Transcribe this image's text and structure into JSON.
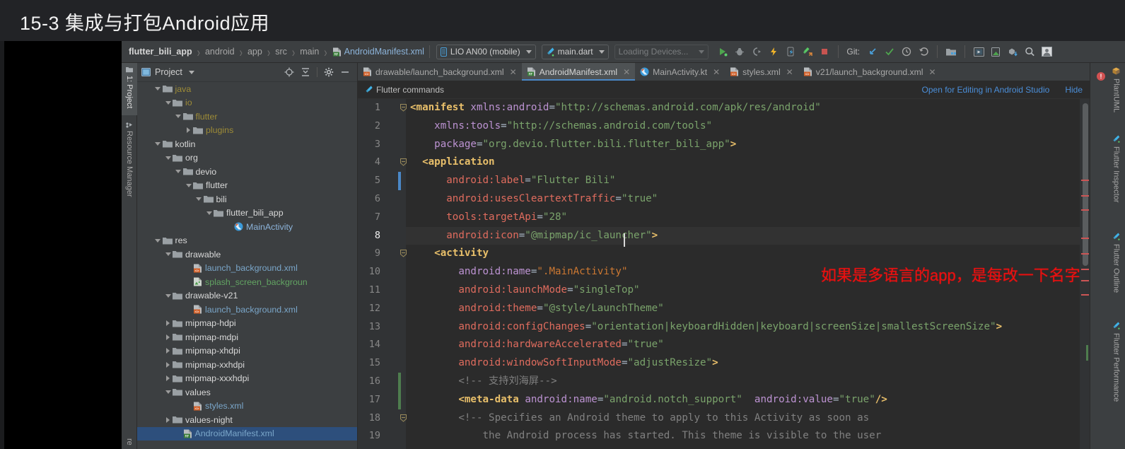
{
  "slide": {
    "title": "15-3 集成与打包Android应用"
  },
  "breadcrumb": {
    "items": [
      {
        "label": "flutter_bili_app",
        "style": "bold"
      },
      {
        "label": "android",
        "style": "normal"
      },
      {
        "label": "app",
        "style": "normal"
      },
      {
        "label": "src",
        "style": "normal"
      },
      {
        "label": "main",
        "style": "normal"
      },
      {
        "label": "AndroidManifest.xml",
        "style": "file",
        "icon": "xml-manifest-icon"
      }
    ],
    "separator": "›"
  },
  "toolbar": {
    "device_selector": "LIO AN00 (mobile)",
    "device_icon": "phone-icon",
    "run_config": "main.dart",
    "run_config_icon": "flutter-icon",
    "loading_devices": "Loading Devices...",
    "git_label": "Git:",
    "buttons": [
      {
        "name": "run-button",
        "icon": "play-icon"
      },
      {
        "name": "debug-button",
        "icon": "bug-icon"
      },
      {
        "name": "run-coverage-button",
        "icon": "coverage-icon"
      },
      {
        "name": "hot-reload-button",
        "icon": "lightning-icon"
      },
      {
        "name": "hot-restart-button",
        "icon": "restart-icon"
      },
      {
        "name": "open-devtools-button",
        "icon": "devtools-icon"
      },
      {
        "name": "stop-button",
        "icon": "stop-icon"
      },
      {
        "name": "git-update-button",
        "icon": "arrow-down-left-icon"
      },
      {
        "name": "git-commit-button",
        "icon": "check-icon"
      },
      {
        "name": "git-history-button",
        "icon": "clock-icon"
      },
      {
        "name": "git-rollback-button",
        "icon": "undo-icon"
      },
      {
        "name": "project-structure-button",
        "icon": "project-structure-icon"
      },
      {
        "name": "avd-manager-button",
        "icon": "avd-icon"
      },
      {
        "name": "sdk-manager-button",
        "icon": "sdk-icon"
      },
      {
        "name": "gradle-sync-button",
        "icon": "sync-icon"
      },
      {
        "name": "search-everywhere-button",
        "icon": "search-icon"
      },
      {
        "name": "account-button",
        "icon": "user-icon"
      }
    ]
  },
  "left_strip": {
    "tabs": [
      {
        "label": "1: Project",
        "active": true,
        "icon": "project-icon"
      },
      {
        "label": "Resource Manager",
        "active": false,
        "icon": "resource-icon"
      },
      {
        "label": "re",
        "active": false,
        "icon": ""
      }
    ]
  },
  "project_panel": {
    "title": "Project",
    "tools": [
      {
        "name": "locate-icon"
      },
      {
        "name": "collapse-all-icon"
      },
      {
        "name": "gear-icon"
      },
      {
        "name": "minimize-icon"
      }
    ],
    "tree": [
      {
        "label": "java",
        "indent": 5,
        "twisty": "down",
        "icon": "folder",
        "color": "pkg"
      },
      {
        "label": "io",
        "indent": 6,
        "twisty": "down",
        "icon": "folder",
        "color": "pkg"
      },
      {
        "label": "flutter",
        "indent": 7,
        "twisty": "down",
        "icon": "folder",
        "color": "pkg"
      },
      {
        "label": "plugins",
        "indent": 8,
        "twisty": "right",
        "icon": "folder",
        "color": "pkg"
      },
      {
        "label": "kotlin",
        "indent": 5,
        "twisty": "down",
        "icon": "folder",
        "color": "white"
      },
      {
        "label": "org",
        "indent": 6,
        "twisty": "down",
        "icon": "folder",
        "color": "white"
      },
      {
        "label": "devio",
        "indent": 7,
        "twisty": "down",
        "icon": "folder",
        "color": "white"
      },
      {
        "label": "flutter",
        "indent": 8,
        "twisty": "down",
        "icon": "folder",
        "color": "white"
      },
      {
        "label": "bili",
        "indent": 9,
        "twisty": "down",
        "icon": "folder",
        "color": "white"
      },
      {
        "label": "flutter_bili_app",
        "indent": 10,
        "twisty": "down",
        "icon": "folder",
        "color": "white"
      },
      {
        "label": "MainActivity",
        "indent": 12,
        "twisty": "none",
        "icon": "kotlin",
        "color": "blue"
      },
      {
        "label": "res",
        "indent": 5,
        "twisty": "down",
        "icon": "folder",
        "color": "white"
      },
      {
        "label": "drawable",
        "indent": 6,
        "twisty": "down",
        "icon": "folder",
        "color": "white"
      },
      {
        "label": "launch_background.xml",
        "indent": 8,
        "twisty": "none",
        "icon": "xml",
        "color": "xml"
      },
      {
        "label": "splash_screen_backgroun",
        "indent": 8,
        "twisty": "none",
        "icon": "png",
        "color": "green"
      },
      {
        "label": "drawable-v21",
        "indent": 6,
        "twisty": "down",
        "icon": "folder",
        "color": "white"
      },
      {
        "label": "launch_background.xml",
        "indent": 8,
        "twisty": "none",
        "icon": "xml",
        "color": "xml"
      },
      {
        "label": "mipmap-hdpi",
        "indent": 6,
        "twisty": "right",
        "icon": "folder",
        "color": "white"
      },
      {
        "label": "mipmap-mdpi",
        "indent": 6,
        "twisty": "right",
        "icon": "folder",
        "color": "white"
      },
      {
        "label": "mipmap-xhdpi",
        "indent": 6,
        "twisty": "right",
        "icon": "folder",
        "color": "white"
      },
      {
        "label": "mipmap-xxhdpi",
        "indent": 6,
        "twisty": "right",
        "icon": "folder",
        "color": "white"
      },
      {
        "label": "mipmap-xxxhdpi",
        "indent": 6,
        "twisty": "right",
        "icon": "folder",
        "color": "white"
      },
      {
        "label": "values",
        "indent": 6,
        "twisty": "down",
        "icon": "folder",
        "color": "white"
      },
      {
        "label": "styles.xml",
        "indent": 8,
        "twisty": "none",
        "icon": "xml",
        "color": "xml"
      },
      {
        "label": "values-night",
        "indent": 6,
        "twisty": "right",
        "icon": "folder",
        "color": "white"
      },
      {
        "label": "AndroidManifest.xml",
        "indent": 7,
        "twisty": "none",
        "icon": "manifest",
        "color": "xml",
        "selected": true
      }
    ]
  },
  "editor": {
    "tabs": [
      {
        "label": "drawable/launch_background.xml",
        "icon": "xml-icon",
        "active": false
      },
      {
        "label": "AndroidManifest.xml",
        "icon": "manifest-icon",
        "active": true
      },
      {
        "label": "MainActivity.kt",
        "icon": "kotlin-icon",
        "active": false
      },
      {
        "label": "styles.xml",
        "icon": "xml-icon",
        "active": false
      },
      {
        "label": "v21/launch_background.xml",
        "icon": "xml-icon",
        "active": false
      }
    ],
    "close_glyph": "✕",
    "flutter_bar": {
      "label": "Flutter commands",
      "icon": "flutter-icon",
      "open_link": "Open for Editing in Android Studio",
      "hide_link": "Hide"
    },
    "annotation": "如果是多语言的app，是每改一下名字打一下包吗?",
    "annotation_color": "#e81010",
    "current_line": 8,
    "lines": [
      {
        "n": 1,
        "fold": "start",
        "tokens": [
          {
            "t": "<manifest ",
            "c": "tag"
          },
          {
            "t": "xmlns:android",
            "c": "attr"
          },
          {
            "t": "=",
            "c": "eq"
          },
          {
            "t": "\"http://schemas.android.com/apk/res/android\"",
            "c": "val"
          }
        ]
      },
      {
        "n": 2,
        "tokens": [
          {
            "t": "    ",
            "c": "plain"
          },
          {
            "t": "xmlns:tools",
            "c": "attr"
          },
          {
            "t": "=",
            "c": "eq"
          },
          {
            "t": "\"http://schemas.android.com/tools\"",
            "c": "val"
          }
        ]
      },
      {
        "n": 3,
        "tokens": [
          {
            "t": "    ",
            "c": "plain"
          },
          {
            "t": "package",
            "c": "attr"
          },
          {
            "t": "=",
            "c": "eq"
          },
          {
            "t": "\"org.devio.flutter.bili.flutter_bili_app\"",
            "c": "val"
          },
          {
            "t": ">",
            "c": "tag"
          }
        ]
      },
      {
        "n": 4,
        "fold": "start",
        "tokens": [
          {
            "t": "  <application",
            "c": "tag"
          }
        ]
      },
      {
        "n": 5,
        "mark": "blue",
        "tokens": [
          {
            "t": "      ",
            "c": "plain"
          },
          {
            "t": "android:label",
            "c": "attrR"
          },
          {
            "t": "=",
            "c": "eq"
          },
          {
            "t": "\"Flutter Bili\"",
            "c": "val"
          }
        ]
      },
      {
        "n": 6,
        "tokens": [
          {
            "t": "      ",
            "c": "plain"
          },
          {
            "t": "android:usesCleartextTraffic",
            "c": "attrR"
          },
          {
            "t": "=",
            "c": "eq"
          },
          {
            "t": "\"true\"",
            "c": "val"
          }
        ]
      },
      {
        "n": 7,
        "tokens": [
          {
            "t": "      ",
            "c": "plain"
          },
          {
            "t": "tools:targetApi",
            "c": "attrR"
          },
          {
            "t": "=",
            "c": "eq"
          },
          {
            "t": "\"28\"",
            "c": "val"
          }
        ]
      },
      {
        "n": 8,
        "current": true,
        "tokens": [
          {
            "t": "      ",
            "c": "plain"
          },
          {
            "t": "android:icon",
            "c": "attrR"
          },
          {
            "t": "=",
            "c": "eq"
          },
          {
            "t": "\"@mipmap/ic_launcher\"",
            "c": "val"
          },
          {
            "t": ">",
            "c": "tag"
          }
        ]
      },
      {
        "n": 9,
        "fold": "start",
        "tokens": [
          {
            "t": "    <activity",
            "c": "tag"
          }
        ]
      },
      {
        "n": 10,
        "tokens": [
          {
            "t": "        ",
            "c": "plain"
          },
          {
            "t": "android:name",
            "c": "attr"
          },
          {
            "t": "=",
            "c": "eq"
          },
          {
            "t": "\".MainActivity\"",
            "c": "valR"
          }
        ]
      },
      {
        "n": 11,
        "tokens": [
          {
            "t": "        ",
            "c": "plain"
          },
          {
            "t": "android:launchMode",
            "c": "attrR"
          },
          {
            "t": "=",
            "c": "eq"
          },
          {
            "t": "\"singleTop\"",
            "c": "val"
          }
        ]
      },
      {
        "n": 12,
        "tokens": [
          {
            "t": "        ",
            "c": "plain"
          },
          {
            "t": "android:theme",
            "c": "attrR"
          },
          {
            "t": "=",
            "c": "eq"
          },
          {
            "t": "\"@style/LaunchTheme\"",
            "c": "val"
          }
        ]
      },
      {
        "n": 13,
        "tokens": [
          {
            "t": "        ",
            "c": "plain"
          },
          {
            "t": "android:configChanges",
            "c": "attrR"
          },
          {
            "t": "=",
            "c": "eq"
          },
          {
            "t": "\"orientation|keyboardHidden|keyboard|screenSize|smallestScreenSize\"",
            "c": "val"
          },
          {
            "t": ">",
            "c": "tag"
          }
        ]
      },
      {
        "n": 14,
        "tokens": [
          {
            "t": "        ",
            "c": "plain"
          },
          {
            "t": "android:hardwareAccelerated",
            "c": "attrR"
          },
          {
            "t": "=",
            "c": "eq"
          },
          {
            "t": "\"true\"",
            "c": "val"
          }
        ]
      },
      {
        "n": 15,
        "tokens": [
          {
            "t": "        ",
            "c": "plain"
          },
          {
            "t": "android:windowSoftInputMode",
            "c": "attrR"
          },
          {
            "t": "=",
            "c": "eq"
          },
          {
            "t": "\"adjustResize\"",
            "c": "val"
          },
          {
            "t": ">",
            "c": "tag"
          }
        ]
      },
      {
        "n": 16,
        "mark": "green",
        "tokens": [
          {
            "t": "        ",
            "c": "plain"
          },
          {
            "t": "<!-- 支持刘海屏-->",
            "c": "cmt"
          }
        ]
      },
      {
        "n": 17,
        "mark": "green",
        "tokens": [
          {
            "t": "        ",
            "c": "plain"
          },
          {
            "t": "<meta-data ",
            "c": "tag"
          },
          {
            "t": "android:name",
            "c": "attr"
          },
          {
            "t": "=",
            "c": "eq"
          },
          {
            "t": "\"android.notch_support\"",
            "c": "val"
          },
          {
            "t": "  ",
            "c": "plain"
          },
          {
            "t": "android:value",
            "c": "attr"
          },
          {
            "t": "=",
            "c": "eq"
          },
          {
            "t": "\"true\"",
            "c": "val"
          },
          {
            "t": "/>",
            "c": "tag"
          }
        ]
      },
      {
        "n": 18,
        "fold": "start",
        "tokens": [
          {
            "t": "        ",
            "c": "plain"
          },
          {
            "t": "<!-- Specifies an Android theme to apply to this Activity as soon as",
            "c": "cmt"
          }
        ]
      },
      {
        "n": 19,
        "tokens": [
          {
            "t": "            ",
            "c": "plain"
          },
          {
            "t": "the Android process has started. This theme is visible to the user",
            "c": "cmt"
          }
        ]
      }
    ]
  },
  "right_strip": {
    "tabs": [
      {
        "label": "PlantUML",
        "icon": "plantuml-icon"
      },
      {
        "label": "Flutter Inspector",
        "icon": "flutter-icon"
      },
      {
        "label": "Flutter Outline",
        "icon": "flutter-icon"
      },
      {
        "label": "Flutter Performance",
        "icon": "flutter-icon"
      }
    ],
    "error_badge": "!"
  },
  "colors": {
    "accent": "#4a88c7",
    "editor_bg": "#2b2b2b",
    "panel_bg": "#3c3f41",
    "selection": "#2d4f7c",
    "annotation": "#e81010"
  }
}
